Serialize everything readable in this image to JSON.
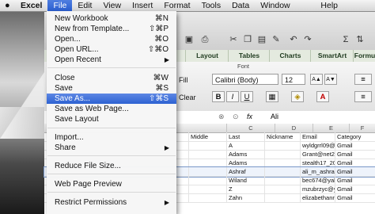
{
  "menubar": {
    "apple": "",
    "items": [
      "Excel",
      "File",
      "Edit",
      "View",
      "Insert",
      "Format",
      "Tools",
      "Data",
      "Window",
      "Help"
    ],
    "active": "File"
  },
  "file_menu": {
    "items": [
      {
        "label": "New Workbook",
        "shortcut": "⌘N"
      },
      {
        "label": "New from Template...",
        "shortcut": "⇧⌘P"
      },
      {
        "label": "Open...",
        "shortcut": "⌘O"
      },
      {
        "label": "Open URL...",
        "shortcut": "⇧⌘O"
      },
      {
        "label": "Open Recent",
        "submenu": true
      },
      {
        "label": "Close",
        "shortcut": "⌘W"
      },
      {
        "label": "Save",
        "shortcut": "⌘S"
      },
      {
        "label": "Save As...",
        "shortcut": "⇧⌘S",
        "highlighted": true
      },
      {
        "label": "Save as Web Page...",
        "shortcut": ""
      },
      {
        "label": "Save Layout",
        "shortcut": ""
      },
      {
        "label": "Import...",
        "shortcut": ""
      },
      {
        "label": "Share",
        "submenu": true
      },
      {
        "label": "Reduce File Size...",
        "shortcut": ""
      },
      {
        "label": "Web Page Preview",
        "shortcut": ""
      },
      {
        "label": "Restrict Permissions",
        "submenu": true
      }
    ],
    "highlight_color": "#2d62d2"
  },
  "ribbon": {
    "tabs": [
      "Layout",
      "Tables",
      "Charts",
      "SmartArt",
      "Formu"
    ],
    "fill_label": "Fill",
    "clear_label": "Clear",
    "font_group_label": "Font",
    "font_name": "Calibri (Body)",
    "font_size": "12",
    "bold": "B",
    "italic": "I",
    "underline": "U",
    "grow_font": "A▲",
    "shrink_font": "A▼",
    "font_color": "A"
  },
  "formula_bar": {
    "fx": "fx",
    "value": "Ali"
  },
  "grid": {
    "columns": [
      "C",
      "D",
      "E",
      "F"
    ],
    "headers": [
      "Middle",
      "Last",
      "Nickname",
      "Email",
      "Category"
    ],
    "rows": [
      {
        "middle": "",
        "last": "A",
        "nickname": "",
        "email": "wyldgrrl09@",
        "category": "Gmail"
      },
      {
        "middle": "",
        "last": "Adams",
        "nickname": "",
        "email": "Grant@net2",
        "category": "Gmail"
      },
      {
        "middle": "",
        "last": "Adams",
        "nickname": "",
        "email": "stealth17_20",
        "category": "Gmail"
      },
      {
        "middle": "",
        "last": "Ashraf",
        "nickname": "",
        "email": "ali_m_ashraf",
        "category": "Gmail",
        "selected": true
      },
      {
        "middle": "",
        "last": "Wiland",
        "nickname": "",
        "email": "bec674@yah",
        "category": "Gmail"
      },
      {
        "middle": "",
        "last": "Z",
        "nickname": "",
        "email": "mzubrzyc@ya",
        "category": "Gmail"
      },
      {
        "middle": "",
        "last": "Zahn",
        "nickname": "",
        "email": "elizabethann",
        "category": "Gmail"
      }
    ]
  }
}
